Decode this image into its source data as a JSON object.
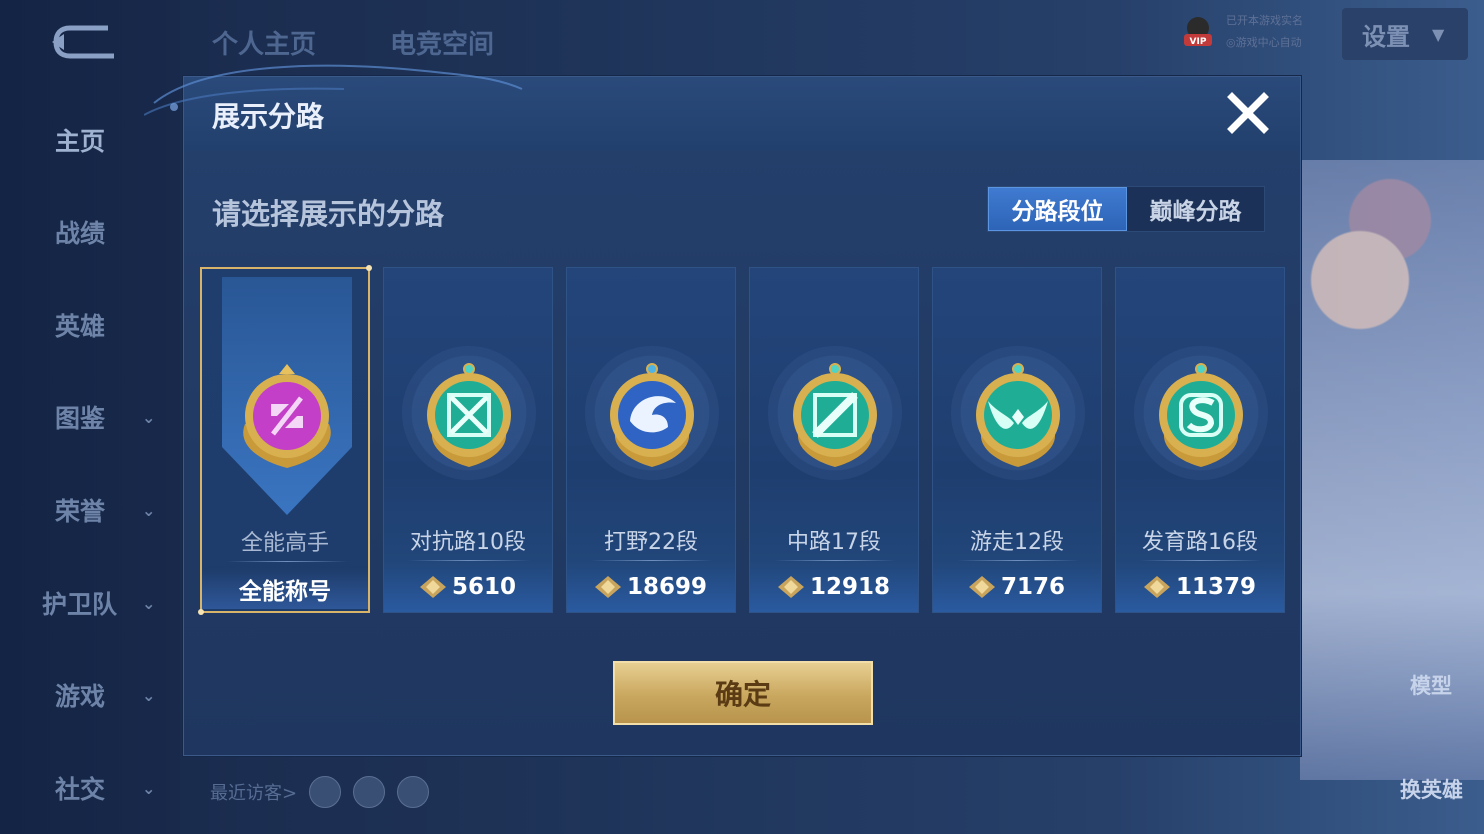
{
  "nav": {
    "items": [
      {
        "label": "主页",
        "chevron": false
      },
      {
        "label": "战绩",
        "chevron": false
      },
      {
        "label": "英雄",
        "chevron": false
      },
      {
        "label": "图鉴",
        "chevron": true
      },
      {
        "label": "荣誉",
        "chevron": true
      },
      {
        "label": "护卫队",
        "chevron": true
      },
      {
        "label": "游戏",
        "chevron": true
      },
      {
        "label": "社交",
        "chevron": true
      }
    ]
  },
  "top_tabs": [
    "个人主页",
    "电竞空间"
  ],
  "vip": {
    "badge": "VIP",
    "line1": "已开本游戏实名",
    "line2": "◎游戏中心自动"
  },
  "settings": {
    "label": "设置",
    "chevron": "▼"
  },
  "side_buttons": {
    "model": "模型",
    "switch_hero": "换英雄"
  },
  "visitors": {
    "label": "最近访客>"
  },
  "modal": {
    "title": "展示分路",
    "subtitle": "请选择展示的分路",
    "close_icon": "close-icon",
    "segment": {
      "options": [
        "分路段位",
        "巅峰分路"
      ],
      "selected": "分路段位"
    },
    "cards": [
      {
        "name": "全能高手",
        "score": "全能称号",
        "icon": "all-round-emblem-icon",
        "selected": true,
        "color": "#c43fc8"
      },
      {
        "name": "对抗路10段",
        "score": "5610",
        "icon": "clash-lane-emblem-icon",
        "selected": false,
        "color": "#22b39a"
      },
      {
        "name": "打野22段",
        "score": "18699",
        "icon": "jungle-dragon-emblem-icon",
        "selected": false,
        "color": "#2f64c4"
      },
      {
        "name": "中路17段",
        "score": "12918",
        "icon": "mid-lane-emblem-icon",
        "selected": false,
        "color": "#22b39a"
      },
      {
        "name": "游走12段",
        "score": "7176",
        "icon": "roam-wings-emblem-icon",
        "selected": false,
        "color": "#22b39a"
      },
      {
        "name": "发育路16段",
        "score": "11379",
        "icon": "farm-lane-emblem-icon",
        "selected": false,
        "color": "#22b39a"
      }
    ],
    "confirm_label": "确定"
  },
  "colors": {
    "gold": "#d8b36a",
    "accent_blue": "#3f7bd1",
    "modal_bg": "#22406d"
  }
}
